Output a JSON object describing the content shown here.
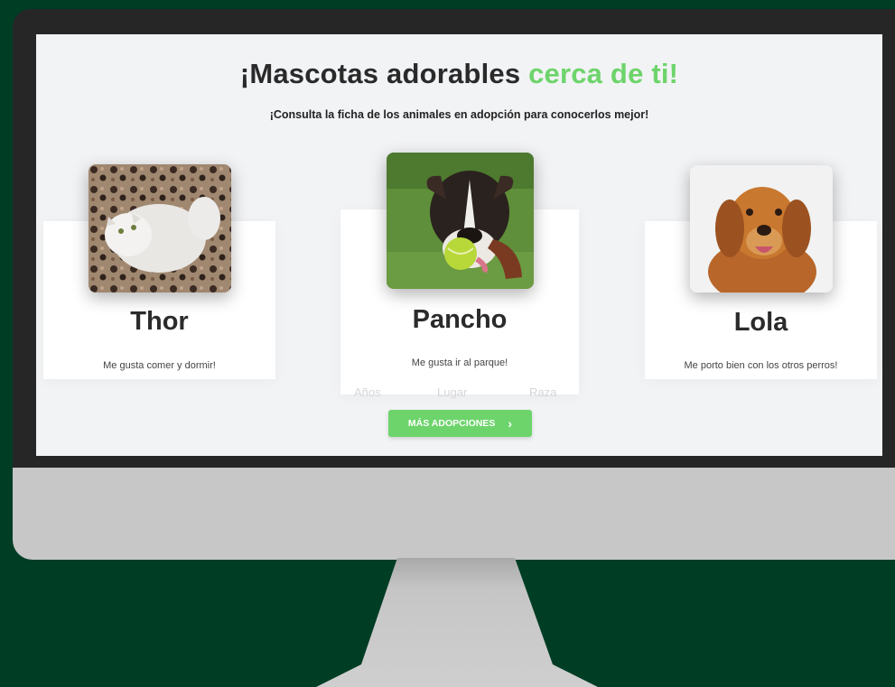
{
  "page": {
    "title_main": "¡Mascotas adorables ",
    "title_accent": "cerca de ti!",
    "subtitle": "¡Consulta la ficha de los animales en adopción para conocerlos mejor!"
  },
  "pets": [
    {
      "name": "Thor",
      "description": "Me gusta comer y dormir!",
      "image_icon": "white-cat-photo"
    },
    {
      "name": "Pancho",
      "description": "Me gusta ir al parque!",
      "image_icon": "boxer-dog-photo"
    },
    {
      "name": "Lola",
      "description": "Me porto bien con los otros perros!",
      "image_icon": "golden-retriever-photo"
    }
  ],
  "faded_info": [
    "Años",
    "Lugar",
    "Raza"
  ],
  "cta": {
    "label": "MÁS ADOPCIONES",
    "icon": "chevron-right-icon"
  },
  "colors": {
    "accent": "#6dd46b",
    "background": "#003d25",
    "screen": "#f2f3f5",
    "bezel": "#262626",
    "chin": "#c7c7c7"
  }
}
